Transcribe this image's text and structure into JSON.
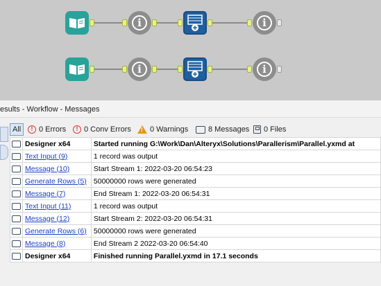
{
  "workflow_rows": [
    [
      "text-input",
      "browse",
      "generate-rows",
      "browse"
    ],
    [
      "text-input",
      "browse",
      "generate-rows",
      "browse"
    ]
  ],
  "results": {
    "title": "esults - Workflow - Messages",
    "filters": {
      "all": "All",
      "errors": "0 Errors",
      "conv_errors": "0 Conv Errors",
      "warnings": "0 Warnings",
      "messages": "8 Messages",
      "files": "0 Files"
    },
    "rows": [
      {
        "tool": "Designer x64",
        "message": "Started running G:\\Work\\Dan\\Alteryx\\Solutions\\Parallerism\\Parallel.yxmd at",
        "link": false,
        "bold": true
      },
      {
        "tool": "Text Input (9)",
        "message": "1 record was output",
        "link": true,
        "bold": false
      },
      {
        "tool": "Message (10)",
        "message": "Start Stream 1: 2022-03-20 06:54:23",
        "link": true,
        "bold": false
      },
      {
        "tool": "Generate Rows (5)",
        "message": "50000000 rows were generated",
        "link": true,
        "bold": false
      },
      {
        "tool": "Message (7)",
        "message": "End Stream 1: 2022-03-20 06:54:31",
        "link": true,
        "bold": false
      },
      {
        "tool": "Text Input (11)",
        "message": "1 record was output",
        "link": true,
        "bold": false
      },
      {
        "tool": "Message (12)",
        "message": "Start Stream 2: 2022-03-20 06:54:31",
        "link": true,
        "bold": false
      },
      {
        "tool": "Generate Rows (6)",
        "message": "50000000 rows were generated",
        "link": true,
        "bold": false
      },
      {
        "tool": "Message (8)",
        "message": "End Stream 2 2022-03-20 06:54:40",
        "link": true,
        "bold": false
      },
      {
        "tool": "Designer x64",
        "message": "Finished running Parallel.yxmd in 17.1 seconds",
        "link": false,
        "bold": true
      }
    ]
  },
  "icons": {
    "text_input": "text-input-book-icon",
    "browse": "browse-info-icon",
    "generate_rows": "generate-rows-icon",
    "error": "error-circle-icon",
    "warning": "warning-triangle-icon",
    "message": "message-bubble-icon",
    "file": "file-save-icon"
  },
  "colors": {
    "canvas_bg": "#c9c9c9",
    "text_input_tool": "#28a39a",
    "generate_rows_tool": "#1f5f9f",
    "browse_tool": "#8d8d8d",
    "anchor": "#e8f08a",
    "link": "#1a3fc4",
    "error": "#d93a3a",
    "warning": "#e09a1a"
  }
}
